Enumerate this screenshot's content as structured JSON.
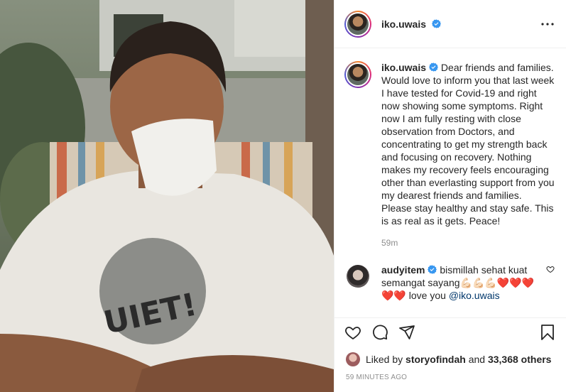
{
  "post": {
    "author": "iko.uwais",
    "verified": true,
    "caption": "Dear friends and families. Would love to inform you that last week I have tested for Covid-19 and right now showing some symptoms. Right now I am fully resting with close observation from Doctors, and concentrating to get my strength back and focusing on recovery. Nothing makes my recovery feels encouraging other than everlasting support from you my dearest friends and families. Please stay healthy and stay safe. This is as real as it gets. Peace!",
    "caption_time": "59m",
    "more_icon": "more-options-icon"
  },
  "comment": {
    "user": "audyitem",
    "verified": true,
    "text": "bismillah sehat kuat semangat sayang",
    "emoji": "💪🏻💪🏻💪🏻❤️❤️❤️❤️❤️",
    "text_after": "love you",
    "mention": "@iko.uwais"
  },
  "actions": {
    "icons": [
      "heart-icon",
      "comment-icon",
      "share-icon",
      "bookmark-icon"
    ]
  },
  "likes": {
    "prefix": "Liked by",
    "user": "storyofindah",
    "and": "and",
    "count": "33,368 others"
  },
  "posted": "59 minutes ago",
  "colors": {
    "verified": "#3897f0",
    "mention": "#00376b",
    "muted": "#8e8e8e"
  }
}
